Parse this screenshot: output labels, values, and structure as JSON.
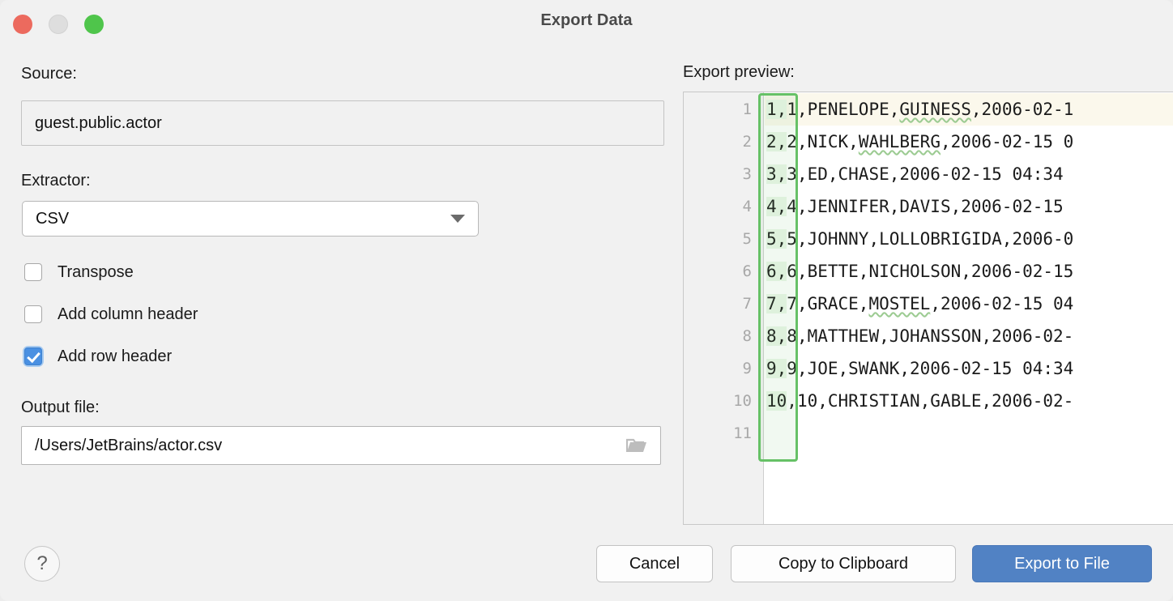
{
  "window": {
    "title": "Export Data",
    "traffic_lights": [
      "close-button",
      "minimize-button",
      "zoom-button"
    ]
  },
  "form": {
    "source_label": "Source:",
    "source_value": "guest.public.actor",
    "extractor_label": "Extractor:",
    "extractor_value": "CSV",
    "extractor_options": [
      "CSV"
    ],
    "checkboxes": [
      {
        "label": "Transpose",
        "checked": false,
        "name": "transpose"
      },
      {
        "label": "Add column header",
        "checked": false,
        "name": "add-column-header"
      },
      {
        "label": "Add row header",
        "checked": true,
        "name": "add-row-header"
      }
    ],
    "output_label": "Output file:",
    "output_value": "/Users/JetBrains/actor.csv",
    "browse_icon": "folder-icon"
  },
  "preview": {
    "label": "Export preview:",
    "line_numbers": [
      "1",
      "2",
      "3",
      "4",
      "5",
      "6",
      "7",
      "8",
      "9",
      "10",
      "11"
    ],
    "lines": [
      {
        "n": "1",
        "row_header": "1,",
        "rest_a": "1,PENELOPE,",
        "misspelled": "GUINESS",
        "rest_b": ",2006-02-1",
        "caret": true
      },
      {
        "n": "2",
        "row_header": "2,",
        "rest_a": "2,NICK,",
        "misspelled": "WAHLBERG",
        "rest_b": ",2006-02-15 0",
        "caret": false
      },
      {
        "n": "3",
        "row_header": "3,",
        "rest_a": "3,ED,CHASE,2006-02-15 04:34",
        "misspelled": "",
        "rest_b": "",
        "caret": false
      },
      {
        "n": "4",
        "row_header": "4,",
        "rest_a": "4,JENNIFER,DAVIS,2006-02-15",
        "misspelled": "",
        "rest_b": "",
        "caret": false
      },
      {
        "n": "5",
        "row_header": "5,",
        "rest_a": "5,JOHNNY,LOLLOBRIGIDA,2006-0",
        "misspelled": "",
        "rest_b": "",
        "caret": false
      },
      {
        "n": "6",
        "row_header": "6,",
        "rest_a": "6,BETTE,NICHOLSON,2006-02-15",
        "misspelled": "",
        "rest_b": "",
        "caret": false
      },
      {
        "n": "7",
        "row_header": "7,",
        "rest_a": "7,GRACE,",
        "misspelled": "MOSTEL",
        "rest_b": ",2006-02-15 04",
        "caret": false
      },
      {
        "n": "8",
        "row_header": "8,",
        "rest_a": "8,MATTHEW,JOHANSSON,2006-02-",
        "misspelled": "",
        "rest_b": "",
        "caret": false
      },
      {
        "n": "9",
        "row_header": "9,",
        "rest_a": "9,JOE,SWANK,2006-02-15 04:34",
        "misspelled": "",
        "rest_b": "",
        "caret": false
      },
      {
        "n": "10",
        "row_header": "10",
        "rest_a": ",10,CHRISTIAN,GABLE,2006-02-",
        "misspelled": "",
        "rest_b": "",
        "caret": false
      },
      {
        "n": "11",
        "row_header": "",
        "rest_a": "",
        "misspelled": "",
        "rest_b": "",
        "caret": false
      }
    ],
    "highlight_note": "row-header column selection"
  },
  "footer": {
    "help_label": "?",
    "cancel_label": "Cancel",
    "copy_label": "Copy to Clipboard",
    "export_label": "Export to File"
  },
  "colors": {
    "window_bg": "#F1F1F1",
    "primary_button": "#5182C4",
    "checkbox_checked": "#4A90E2",
    "selection_frame": "#66C166",
    "selection_fill": "#EAF7E8",
    "caret_line": "#FBF8EC",
    "traffic_red": "#EC6A5E",
    "traffic_yellow": "#DEDEDE",
    "traffic_green": "#4FC54B"
  }
}
